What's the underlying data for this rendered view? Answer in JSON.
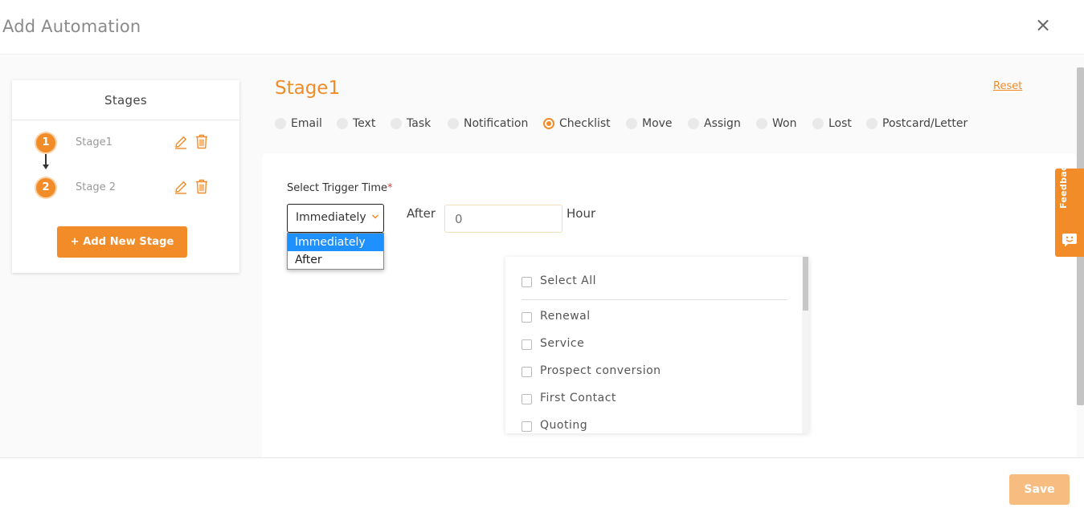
{
  "modal": {
    "title": "Add Automation",
    "close_symbol": "×",
    "close_icon": "close-icon"
  },
  "stages_panel": {
    "header": "Stages",
    "items": [
      {
        "number": "1",
        "name": "Stage1"
      },
      {
        "number": "2",
        "name": "Stage 2"
      }
    ],
    "add_button": "+ Add New Stage"
  },
  "stage": {
    "title": "Stage1",
    "reset": "Reset"
  },
  "action_types": {
    "selected": "Checklist",
    "options": [
      "Email",
      "Text",
      "Task",
      "Notification",
      "Checklist",
      "Move",
      "Assign",
      "Won",
      "Lost",
      "Postcard/Letter"
    ]
  },
  "trigger": {
    "label": "Select Trigger Time",
    "required_mark": "*",
    "selected": "Immediately",
    "options": [
      "Immediately",
      "After"
    ],
    "after_label": "After",
    "hours_placeholder": "0",
    "hour_label": "Hour"
  },
  "checklist": {
    "select_all": "Select All",
    "items": [
      "Renewal",
      "Service",
      "Prospect conversion",
      "First Contact",
      "Quoting"
    ]
  },
  "feedback_tab": {
    "label": "Feedback"
  },
  "footer": {
    "save": "Save"
  },
  "colors": {
    "accent": "#f28c28",
    "save_disabled": "#f7bc80",
    "dropdown_selected": "#1e90ff"
  }
}
